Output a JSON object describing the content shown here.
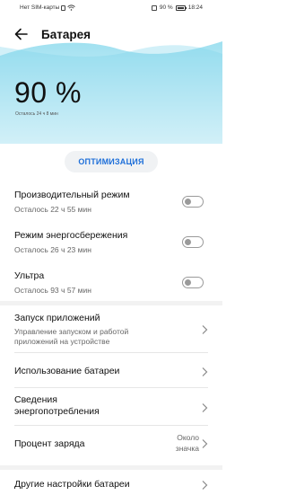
{
  "status_bar": {
    "left_text": "Нет SIM-карты",
    "battery_pct": "90 %",
    "time": "18:24"
  },
  "header": {
    "back_icon": "arrow-left-icon",
    "title": "Батарея"
  },
  "hero": {
    "percent": "90 %",
    "remaining": "Осталось 24 ч 8 мин",
    "wave_color": "#7fd3ea"
  },
  "optimize_button": {
    "label": "ОПТИМИЗАЦИЯ",
    "color": "#1e6fd9"
  },
  "modes": [
    {
      "label": "Производительный режим",
      "sub": "Осталось 22 ч 55 мин",
      "on": false
    },
    {
      "label": "Режим энергосбережения",
      "sub": "Осталось 26 ч 23 мин",
      "on": false
    },
    {
      "label": "Ультра",
      "sub": "Осталось 93 ч 57 мин",
      "on": false
    }
  ],
  "settings": [
    {
      "label": "Запуск приложений",
      "sub_line1": "Управление запуском и работой",
      "sub_line2": "приложений на устройстве"
    },
    {
      "label": "Использование батареи"
    },
    {
      "label_line1": "Сведения",
      "label_line2": "энергопотребления"
    },
    {
      "label": "Процент заряда",
      "value_line1": "Около",
      "value_line2": "значка"
    }
  ],
  "other": {
    "label": "Другие настройки батареи"
  }
}
